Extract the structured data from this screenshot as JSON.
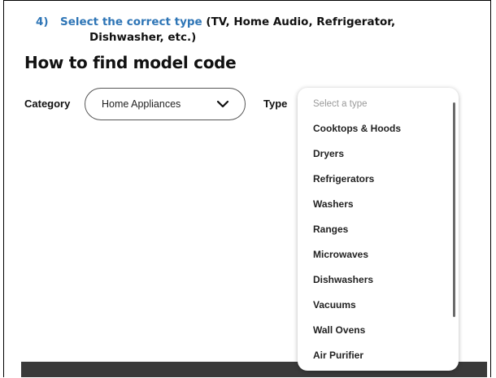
{
  "instruction": {
    "number": "4)",
    "highlight": "Select the correct type",
    "rest_line1": " (TV, Home Audio, Refrigerator,",
    "rest_line2": "Dishwasher, etc.)",
    "accent_color": "#2e75b6"
  },
  "page": {
    "title": "How to find model code"
  },
  "category": {
    "label": "Category",
    "value": "Home Appliances",
    "icon": "chevron-down-icon"
  },
  "type": {
    "label": "Type",
    "placeholder": "Select a type",
    "options": [
      "Cooktops & Hoods",
      "Dryers",
      "Refrigerators",
      "Washers",
      "Ranges",
      "Microwaves",
      "Dishwashers",
      "Vacuums",
      "Wall Ovens",
      "Air Purifier"
    ]
  }
}
